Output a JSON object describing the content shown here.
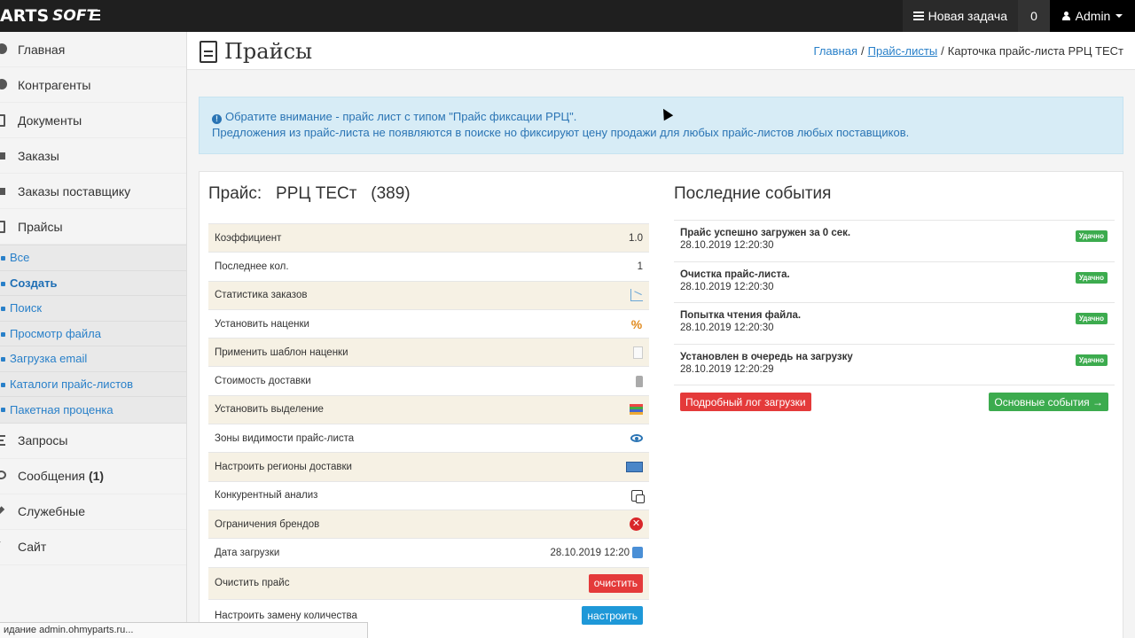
{
  "topbar": {
    "logo_left": "ARTS",
    "logo_right": "SOFT",
    "new_task_label": "Новая задача",
    "counter": "0",
    "user_label": "Admin"
  },
  "sidebar": {
    "items": [
      {
        "label": "Главная",
        "icon": "home-icon"
      },
      {
        "label": "Контрагенты",
        "icon": "users-icon"
      },
      {
        "label": "Документы",
        "icon": "documents-icon"
      },
      {
        "label": "Заказы",
        "icon": "cart-icon"
      },
      {
        "label": "Заказы поставщику",
        "icon": "truck-icon"
      },
      {
        "label": "Прайсы",
        "icon": "file-icon"
      }
    ],
    "submenu": [
      {
        "label": "Все"
      },
      {
        "label": "Создать"
      },
      {
        "label": "Поиск"
      },
      {
        "label": "Просмотр файла"
      },
      {
        "label": "Загрузка email"
      },
      {
        "label": "Каталоги прайс-листов"
      },
      {
        "label": "Пакетная проценка"
      }
    ],
    "items_after": [
      {
        "label": "Запросы",
        "icon": "list-icon"
      },
      {
        "label": "Сообщения",
        "badge": "(1)",
        "icon": "messages-icon"
      },
      {
        "label": "Служебные",
        "icon": "wrench-icon"
      },
      {
        "label": "Сайт",
        "icon": "site-icon"
      }
    ]
  },
  "header": {
    "title": "Прайсы",
    "breadcrumb": {
      "home": "Главная",
      "sep1": "/",
      "pricelists": "Прайс-листы",
      "sep2": "/",
      "current": "Карточка прайс-листа РРЦ ТЕСт"
    }
  },
  "alert": {
    "line1": "Обратите внимание - прайс лист с типом \"Прайс фиксации РРЦ\".",
    "line2": "Предложения из прайс-листа не появляются в поиске но фиксируют цену продажи для любых прайс-листов любых поставщиков."
  },
  "price": {
    "title_label": "Прайс:",
    "name": "РРЦ ТЕСт",
    "count": "(389)",
    "rows": [
      {
        "label": "Коэффициент",
        "value": "1.0"
      },
      {
        "label": "Последнее кол.",
        "value": "1"
      },
      {
        "label": "Статистика заказов",
        "icon": "chart-icon"
      },
      {
        "label": "Установить наценки",
        "icon": "percent-icon"
      },
      {
        "label": "Применить шаблон наценки",
        "icon": "page-icon"
      },
      {
        "label": "Стоимость доставки",
        "icon": "bottle-icon"
      },
      {
        "label": "Установить выделение",
        "icon": "palette-icon"
      },
      {
        "label": "Зоны видимости прайс-листа",
        "icon": "eye-icon"
      },
      {
        "label": "Настроить регионы доставки",
        "icon": "map-icon"
      },
      {
        "label": "Конкурентный анализ",
        "icon": "compare-icon"
      },
      {
        "label": "Ограничения брендов",
        "icon": "stop-icon"
      },
      {
        "label": "Дата загрузки",
        "value": "28.10.2019 12:20",
        "icon": "refresh-icon"
      },
      {
        "label": "Очистить прайс",
        "button": "очистить"
      },
      {
        "label": "Настроить замену количества",
        "button": "настроить"
      }
    ]
  },
  "events": {
    "title": "Последние события",
    "items": [
      {
        "title": "Прайс успешно загружен за 0 сек.",
        "time": "28.10.2019 12:20:30",
        "status": "Удачно"
      },
      {
        "title": "Очистка прайс-листа.",
        "time": "28.10.2019 12:20:30",
        "status": "Удачно"
      },
      {
        "title": "Попытка чтения файла.",
        "time": "28.10.2019 12:20:30",
        "status": "Удачно"
      },
      {
        "title": "Установлен в очередь на загрузку",
        "time": "28.10.2019 12:20:29",
        "status": "Удачно"
      }
    ],
    "log_button": "Подробный лог загрузки",
    "main_events_button": "Основные события →"
  },
  "statusbar": {
    "text": "идание admin.ohmyparts.ru..."
  },
  "colors": {
    "topbar": "#1f1f1f",
    "link": "#2980c9",
    "alert_bg": "#d7ecf6",
    "success": "#3cab4e",
    "danger": "#e43a3a",
    "primary": "#1e98d8"
  }
}
